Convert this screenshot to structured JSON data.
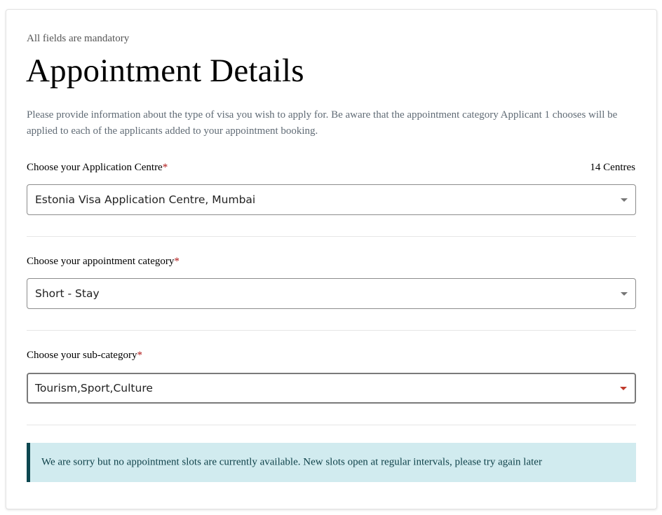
{
  "header": {
    "mandatory_note": "All fields are mandatory",
    "title": "Appointment Details",
    "intro": "Please provide information about the type of visa you wish to apply for. Be aware that the appointment category Applicant 1 chooses will be applied to each of the applicants added to your appointment booking."
  },
  "fields": {
    "required_marker": "*",
    "centre": {
      "label": "Choose your Application Centre",
      "count": "14 Centres",
      "value": "Estonia Visa Application Centre, Mumbai"
    },
    "category": {
      "label": "Choose your appointment category",
      "value": "Short - Stay"
    },
    "subcategory": {
      "label": "Choose your sub-category",
      "value": "Tourism,Sport,Culture"
    }
  },
  "alert": {
    "message": "We are sorry but no appointment slots are currently available. New slots open at regular intervals, please try again later"
  },
  "colors": {
    "required": "#b01818",
    "alert_background": "#d1ebef",
    "alert_border": "#0d4750",
    "active_caret": "#c0392b"
  },
  "icons": {
    "dropdown": "caret-down-icon"
  }
}
